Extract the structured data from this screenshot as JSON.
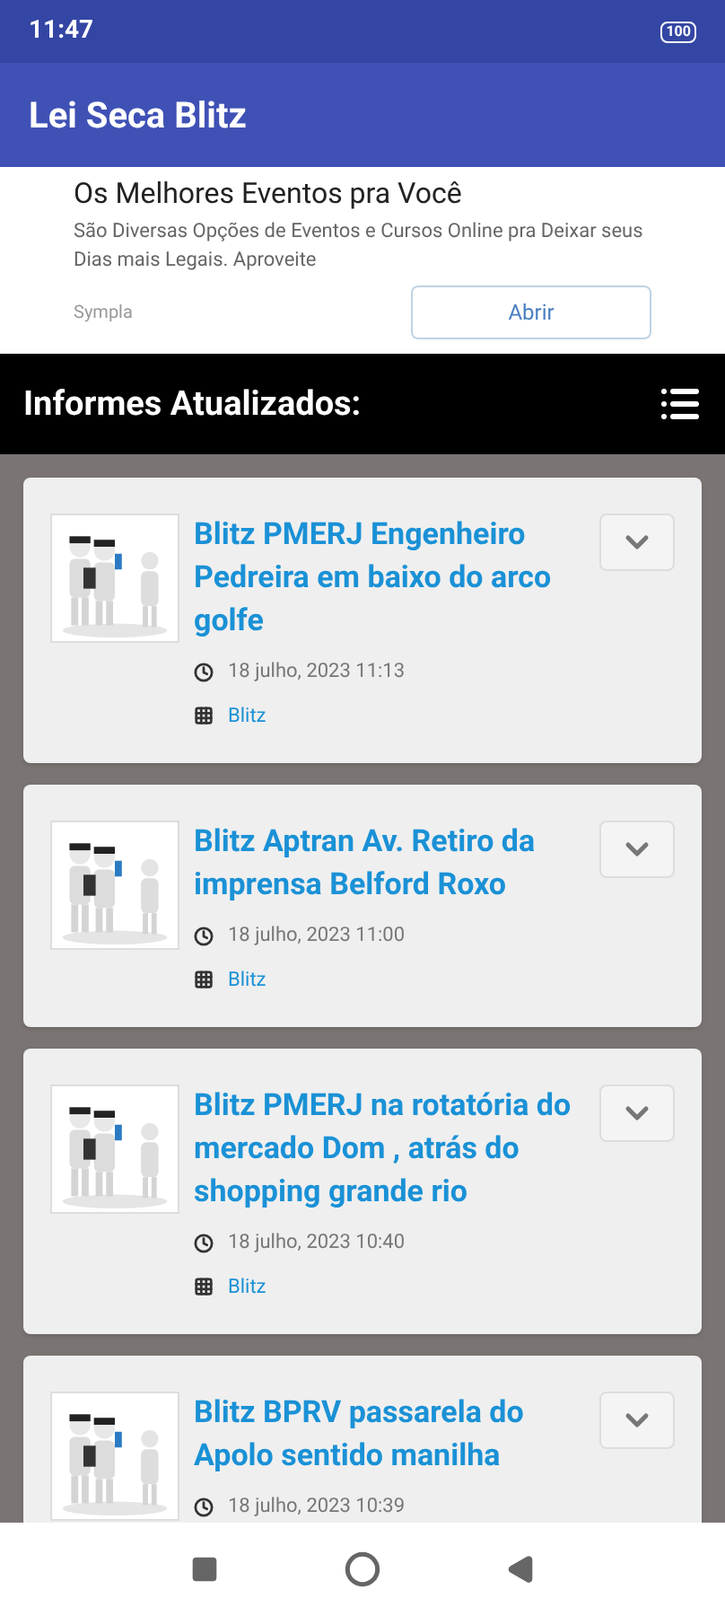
{
  "status_bar": {
    "time": "11:47",
    "battery": "100"
  },
  "app_bar": {
    "title": "Lei Seca Blitz"
  },
  "ad": {
    "headline": "Os Melhores Eventos pra Você",
    "body": "São Diversas Opções de Eventos e Cursos Online pra Deixar seus Dias mais Legais. Aproveite",
    "advertiser": "Sympla",
    "button": "Abrir"
  },
  "section": {
    "title": "Informes Atualizados:"
  },
  "posts": [
    {
      "title": "Blitz PMERJ Engenheiro Pedreira em baixo do arco golfe",
      "date": "18 julho, 2023 11:13",
      "category": "Blitz"
    },
    {
      "title": "Blitz Aptran Av. Retiro da imprensa Belford Roxo",
      "date": "18 julho, 2023 11:00",
      "category": "Blitz"
    },
    {
      "title": "Blitz PMERJ na rotatória do mercado Dom , atrás do shopping grande rio",
      "date": "18 julho, 2023 10:40",
      "category": "Blitz"
    },
    {
      "title": "Blitz BPRV passarela do Apolo sentido manilha",
      "date": "18 julho, 2023 10:39"
    }
  ]
}
